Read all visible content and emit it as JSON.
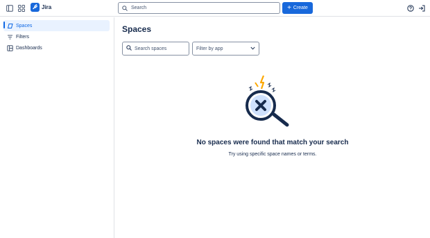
{
  "topbar": {
    "app_name": "Jira",
    "search_placeholder": "Search",
    "create_label": "Create",
    "icons": [
      "sidebar-toggle-icon",
      "app-switcher-icon",
      "jira-logo",
      "search-icon",
      "help-icon",
      "sign-out-icon"
    ]
  },
  "sidebar": {
    "items": [
      {
        "label": "Spaces",
        "icon": "spaces-icon",
        "active": true
      },
      {
        "label": "Filters",
        "icon": "filter-icon",
        "active": false
      },
      {
        "label": "Dashboards",
        "icon": "dashboard-icon",
        "active": false
      }
    ]
  },
  "main": {
    "title": "Spaces",
    "search_placeholder": "Search spaces",
    "filter_label": "Filter by app",
    "empty_title": "No spaces were found that match your search",
    "empty_subtitle": "Try using specific space names or terms."
  },
  "colors": {
    "brand": "#1868db",
    "active_bg": "#e9f2ff",
    "active_text": "#0c66e4",
    "text": "#172b4d",
    "border": "#dfe1e6"
  }
}
